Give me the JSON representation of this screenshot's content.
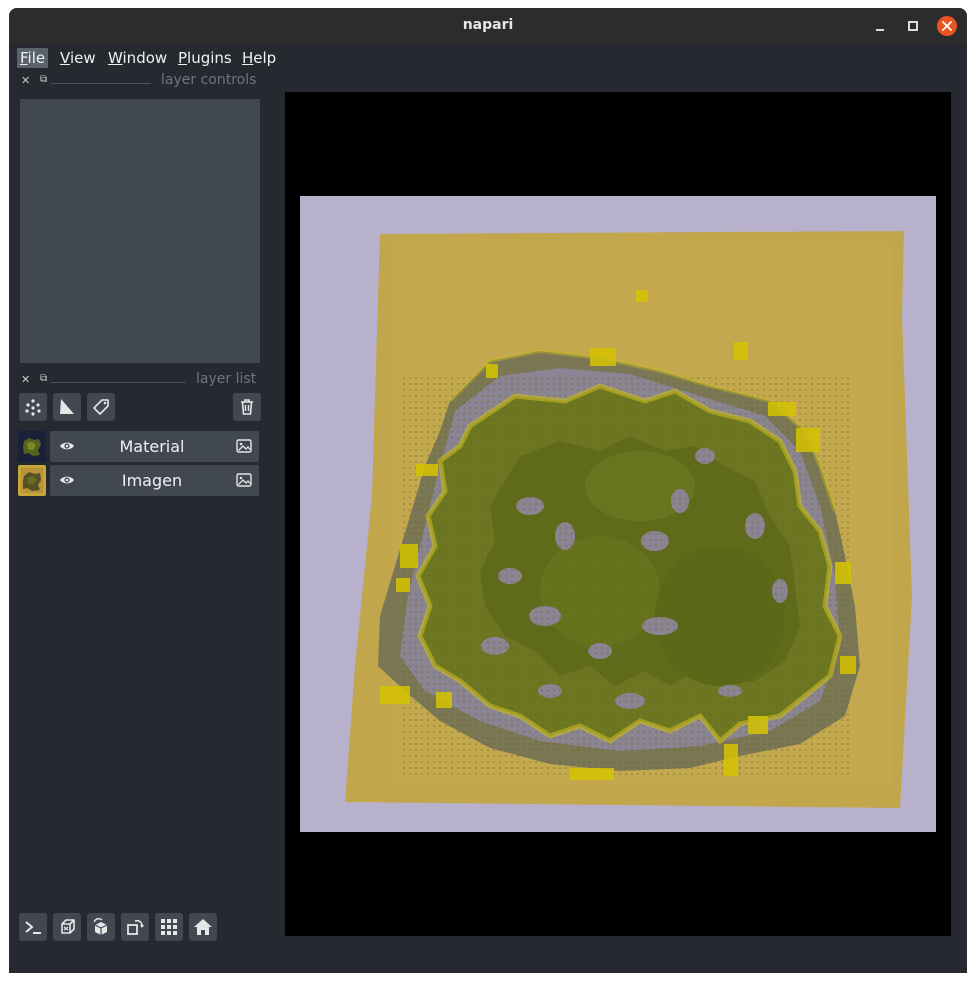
{
  "window": {
    "title": "napari",
    "close_color": "#e95420"
  },
  "menu": {
    "items": [
      {
        "label": "File",
        "underline": "F",
        "rest": "ile",
        "active": true
      },
      {
        "label": "View",
        "underline": "V",
        "rest": "iew",
        "active": false
      },
      {
        "label": "Window",
        "underline": "W",
        "rest": "indow",
        "active": false
      },
      {
        "label": "Plugins",
        "underline": "P",
        "rest": "lugins",
        "active": false
      },
      {
        "label": "Help",
        "underline": "H",
        "rest": "elp",
        "active": false
      }
    ]
  },
  "docks": {
    "layer_controls_title": "layer controls",
    "layer_list_title": "layer list"
  },
  "layer_tools": [
    {
      "name": "new-points-layer-button",
      "icon": "points-icon"
    },
    {
      "name": "new-shapes-layer-button",
      "icon": "shapes-icon"
    },
    {
      "name": "new-labels-layer-button",
      "icon": "labels-icon"
    },
    {
      "name": "delete-layer-button",
      "icon": "trash-icon"
    }
  ],
  "layers": [
    {
      "name": "Material",
      "visible": true,
      "type_icon": "image-icon"
    },
    {
      "name": "Imagen",
      "visible": true,
      "type_icon": "image-icon"
    }
  ],
  "viewer_buttons": [
    {
      "name": "console-button",
      "icon": "console-icon"
    },
    {
      "name": "ndisplay-button",
      "icon": "cube-3d-icon"
    },
    {
      "name": "roll-dims-button",
      "icon": "roll-icon"
    },
    {
      "name": "transpose-dims-button",
      "icon": "transpose-icon"
    },
    {
      "name": "grid-view-button",
      "icon": "grid-icon"
    },
    {
      "name": "home-button",
      "icon": "home-icon"
    }
  ],
  "colors": {
    "background": "#262930",
    "panel": "#414851",
    "text": "#f0f1f2",
    "overlay_yellow": "#d6c400",
    "biofilm_green": "#6f7a1c"
  }
}
